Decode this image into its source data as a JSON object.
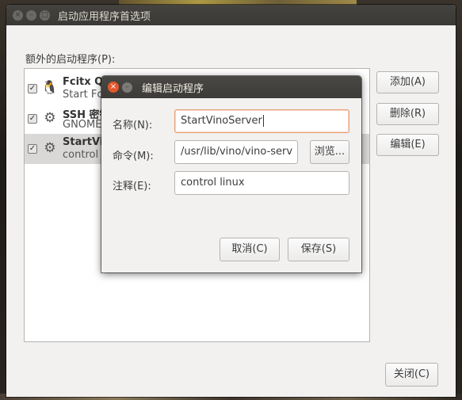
{
  "main_window": {
    "title": "启动应用程序首选项",
    "section_label": "额外的启动程序(P):",
    "startup_programs": [
      {
        "checked": true,
        "icon": "fcitx-penguin-icon",
        "name": "Fcitx QIMPanel",
        "description": "Start Fcitx"
      },
      {
        "checked": true,
        "icon": "gears-icon",
        "name": "SSH 密钥",
        "description": "GNOME"
      },
      {
        "checked": true,
        "icon": "gears-icon",
        "name": "StartVinoServer",
        "description": "control linux",
        "selected": true
      }
    ],
    "add_label": "添加(A)",
    "remove_label": "删除(R)",
    "edit_label": "编辑(E)",
    "close_label": "关闭(C)"
  },
  "dialog": {
    "title": "编辑启动程序",
    "name_label": "名称(N):",
    "name_value": "StartVinoServer",
    "command_label": "命令(M):",
    "command_value": "/usr/lib/vino/vino-serv",
    "browse_label": "浏览...",
    "comment_label": "注释(E):",
    "comment_value": "control linux",
    "cancel_label": "取消(C)",
    "save_label": "保存(S)"
  },
  "colors": {
    "titlebar": "#3c3b37",
    "window_bg": "#f2f1f0",
    "close_button": "#e2582c",
    "focus_border": "#e5a070",
    "selected_row": "#d9d8d6"
  }
}
